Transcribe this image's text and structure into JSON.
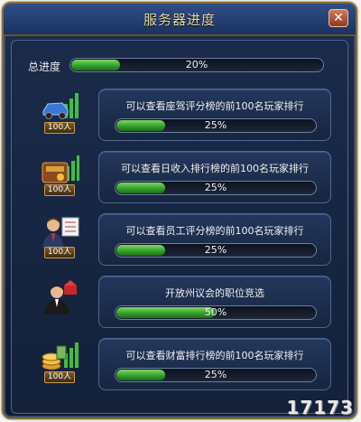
{
  "window": {
    "title": "服务器进度",
    "close_symbol": "✕"
  },
  "overall": {
    "label": "总进度",
    "progress_text": "20%",
    "progress": 0.2
  },
  "tasks": [
    {
      "icon": "car-chart-icon",
      "badge": "100人",
      "text": "可以查看座驾评分榜的前100名玩家排行",
      "progress_text": "25%",
      "progress": 0.25
    },
    {
      "icon": "money-bag-chart-icon",
      "badge": "100人",
      "text": "可以查看日收入排行榜的前100名玩家排行",
      "progress_text": "25%",
      "progress": 0.25
    },
    {
      "icon": "staff-person-icon",
      "badge": "100人",
      "text": "可以查看员工评分榜的前100名玩家排行",
      "progress_text": "25%",
      "progress": 0.25
    },
    {
      "icon": "council-member-icon",
      "badge": "",
      "text": "开放州议会的职位竞选",
      "progress_text": "50%",
      "progress": 0.5
    },
    {
      "icon": "wealth-coins-icon",
      "badge": "100人",
      "text": "可以查看财富排行榜的前100名玩家排行",
      "progress_text": "25%",
      "progress": 0.25
    }
  ],
  "watermark": "17173"
}
